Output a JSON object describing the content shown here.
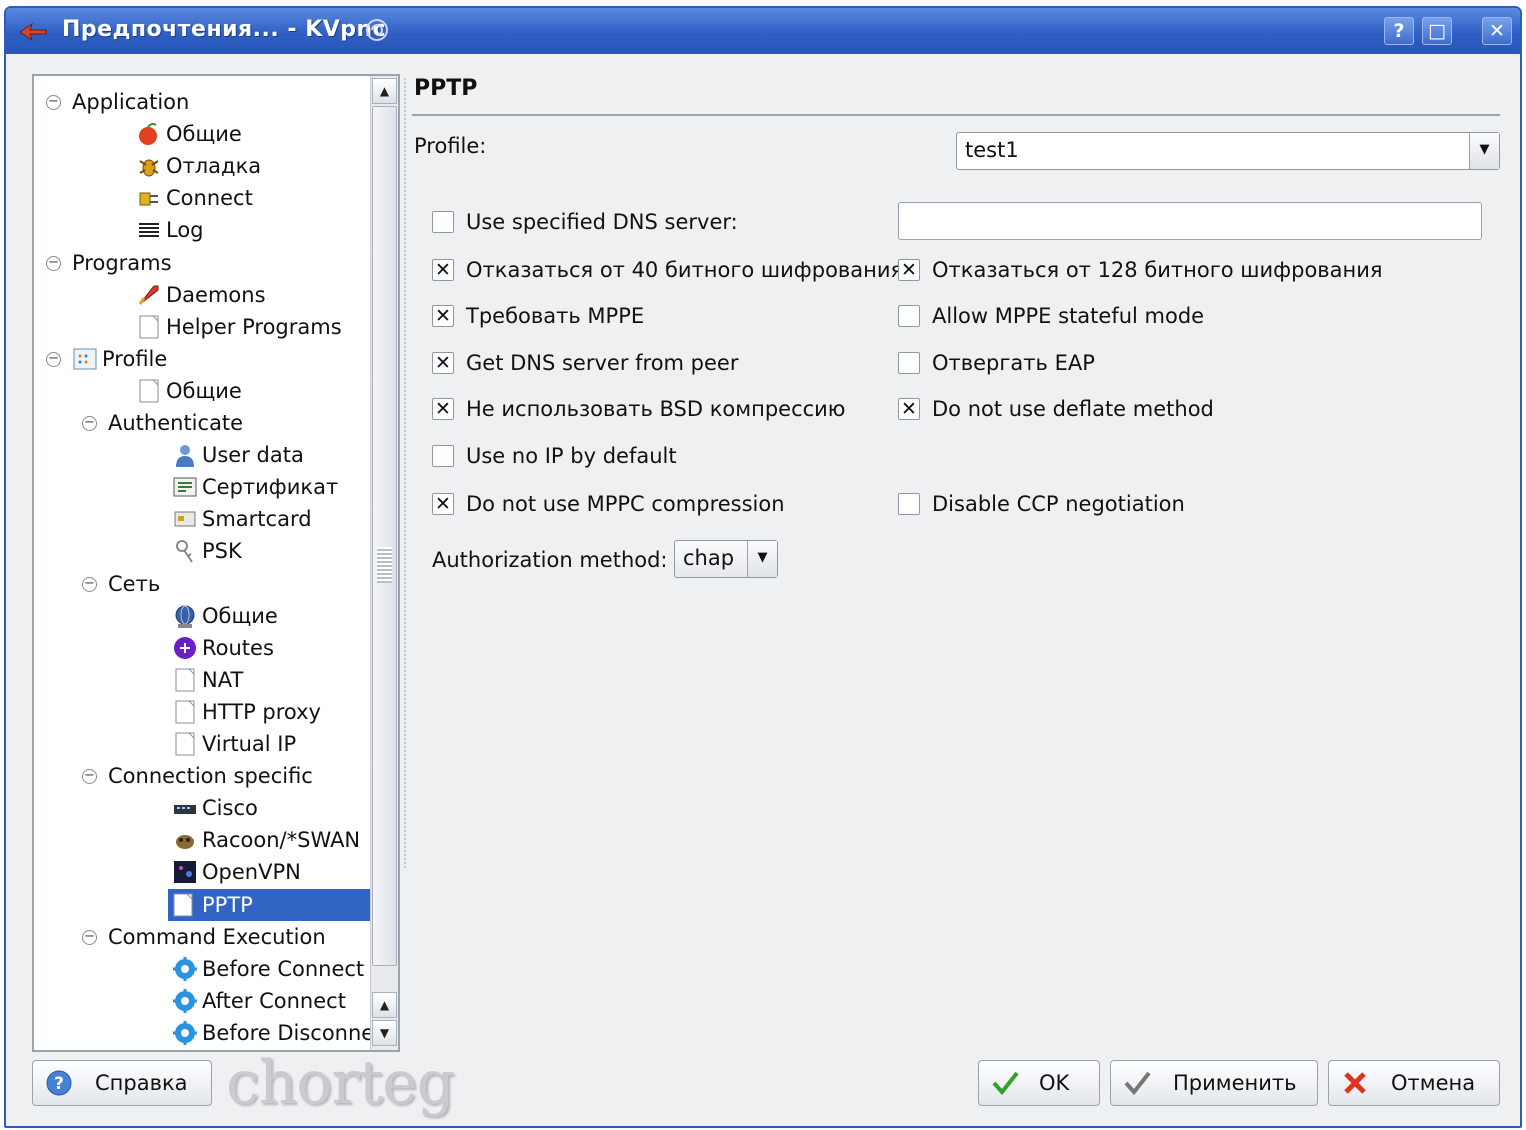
{
  "window": {
    "title": "Предпочтения... - KVpnc",
    "buttons": {
      "help": "?",
      "maximize": "□",
      "close": "✕"
    }
  },
  "tree": {
    "items": [
      {
        "label": "Application",
        "level": 0,
        "expander": "⊖",
        "icon": "none"
      },
      {
        "label": "Общие",
        "level": 1,
        "icon": "apple-icon"
      },
      {
        "label": "Отладка",
        "level": 1,
        "icon": "bug-icon"
      },
      {
        "label": "Connect",
        "level": 1,
        "icon": "connect-plug-icon"
      },
      {
        "label": "Log",
        "level": 1,
        "icon": "log-lines-icon"
      },
      {
        "label": "Programs",
        "level": 0,
        "expander": "⊖",
        "icon": "none"
      },
      {
        "label": "Daemons",
        "level": 1,
        "icon": "rocket-icon"
      },
      {
        "label": "Helper Programs",
        "level": 1,
        "icon": "blank-page-icon"
      },
      {
        "label": "Profile",
        "level": 0,
        "expander": "⊖",
        "icon": "profile-grid-icon"
      },
      {
        "label": "Общие",
        "level": 1,
        "icon": "blank-page-icon"
      },
      {
        "label": "Authenticate",
        "level": 1,
        "expander": "⊖",
        "icon": "none"
      },
      {
        "label": "User data",
        "level": 2,
        "icon": "user-icon"
      },
      {
        "label": "Сертификат",
        "level": 2,
        "icon": "certificate-icon"
      },
      {
        "label": "Smartcard",
        "level": 2,
        "icon": "smartcard-icon"
      },
      {
        "label": "PSK",
        "level": 2,
        "icon": "key-icon"
      },
      {
        "label": "Сеть",
        "level": 1,
        "expander": "⊖",
        "icon": "none"
      },
      {
        "label": "Общие",
        "level": 2,
        "icon": "network-globe-icon"
      },
      {
        "label": "Routes",
        "level": 2,
        "icon": "routes-icon"
      },
      {
        "label": "NAT",
        "level": 2,
        "icon": "blank-page-icon"
      },
      {
        "label": "HTTP proxy",
        "level": 2,
        "icon": "blank-page-icon"
      },
      {
        "label": "Virtual IP",
        "level": 2,
        "icon": "blank-page-icon"
      },
      {
        "label": "Connection specific",
        "level": 1,
        "expander": "⊖",
        "icon": "none"
      },
      {
        "label": "Cisco",
        "level": 2,
        "icon": "cisco-device-icon"
      },
      {
        "label": "Racoon/*SWAN",
        "level": 2,
        "icon": "racoon-icon"
      },
      {
        "label": "OpenVPN",
        "level": 2,
        "icon": "openvpn-icon"
      },
      {
        "label": "PPTP",
        "level": 2,
        "icon": "blank-page-icon",
        "selected": true
      },
      {
        "label": "Command Execution",
        "level": 1,
        "expander": "⊖",
        "icon": "none"
      },
      {
        "label": "Before Connect",
        "level": 2,
        "icon": "gear-blue-icon"
      },
      {
        "label": "After Connect",
        "level": 2,
        "icon": "gear-blue-icon"
      },
      {
        "label": "Before Disconnect",
        "level": 2,
        "icon": "gear-blue-icon"
      }
    ]
  },
  "panel": {
    "title": "PPTP",
    "profile_label": "Profile:",
    "profile_value": "test1",
    "dns_input_value": "",
    "checkboxes": [
      {
        "id": "use-dns",
        "label": "Use specified DNS server:",
        "checked": false
      },
      {
        "id": "refuse-40",
        "label": "Отказаться от 40 битного шифрования",
        "checked": true
      },
      {
        "id": "refuse-128",
        "label": "Отказаться от 128 битного шифрования",
        "checked": true
      },
      {
        "id": "require-mppe",
        "label": "Требовать MPPE",
        "checked": true
      },
      {
        "id": "mppe-stateful",
        "label": "Allow MPPE stateful mode",
        "checked": false
      },
      {
        "id": "dns-from-peer",
        "label": "Get DNS server from peer",
        "checked": true
      },
      {
        "id": "refuse-eap",
        "label": "Отвергать EAP",
        "checked": false
      },
      {
        "id": "no-bsd",
        "label": "Не использовать BSD компрессию",
        "checked": true
      },
      {
        "id": "no-deflate",
        "label": "Do not use deflate method",
        "checked": true
      },
      {
        "id": "no-ip-default",
        "label": "Use no IP by default",
        "checked": false
      },
      {
        "id": "no-mppc",
        "label": "Do not use MPPC compression",
        "checked": true
      },
      {
        "id": "disable-ccp",
        "label": "Disable CCP negotiation",
        "checked": false
      }
    ],
    "auth_label": "Authorization method:",
    "auth_value": "chap"
  },
  "buttons": {
    "help": "Справка",
    "ok": "OK",
    "apply": "Применить",
    "cancel": "Отмена"
  },
  "watermark": "chorteg",
  "colors": {
    "selection": "#3264c6",
    "titlebar": "#2f5fc4"
  }
}
